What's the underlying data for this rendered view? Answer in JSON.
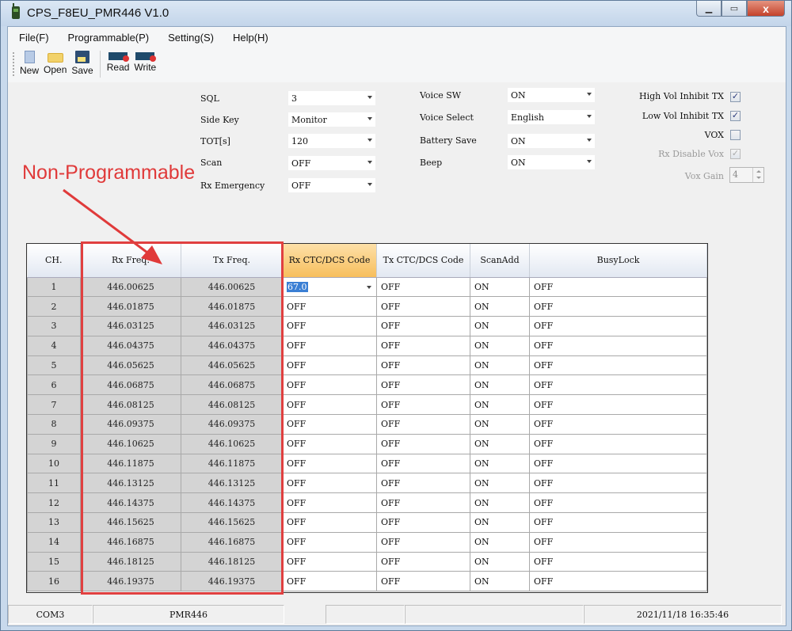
{
  "window": {
    "title": "CPS_F8EU_PMR446 V1.0",
    "controls": {
      "minimize": "minimize",
      "maximize": "maximize",
      "close": "x"
    }
  },
  "menu": [
    {
      "label": "File(F)"
    },
    {
      "label": "Programmable(P)"
    },
    {
      "label": "Setting(S)"
    },
    {
      "label": "Help(H)"
    }
  ],
  "toolbar": [
    {
      "label": "New",
      "icon": "new-file-icon"
    },
    {
      "label": "Open",
      "icon": "folder-open-icon"
    },
    {
      "label": "Save",
      "icon": "floppy-disk-icon"
    },
    {
      "label": "Read",
      "icon": "read-radio-icon"
    },
    {
      "label": "Write",
      "icon": "write-radio-icon"
    }
  ],
  "settings_left": [
    {
      "label": "SQL",
      "value": "3"
    },
    {
      "label": "Side Key",
      "value": "Monitor"
    },
    {
      "label": "TOT[s]",
      "value": "120"
    },
    {
      "label": "Scan",
      "value": "OFF"
    },
    {
      "label": "Rx Emergency",
      "value": "OFF"
    }
  ],
  "settings_mid": [
    {
      "label": "Voice SW",
      "value": "ON"
    },
    {
      "label": "Voice Select",
      "value": "English"
    },
    {
      "label": "Battery Save",
      "value": "ON"
    },
    {
      "label": "Beep",
      "value": "ON"
    }
  ],
  "settings_right": [
    {
      "label": "High Vol Inhibit TX",
      "checked": true,
      "mark": "✓",
      "disabled": false
    },
    {
      "label": "Low Vol Inhibit TX",
      "checked": true,
      "mark": "✓",
      "disabled": false
    },
    {
      "label": "VOX",
      "checked": false,
      "mark": "",
      "disabled": false
    },
    {
      "label": "Rx Disable Vox",
      "checked": true,
      "mark": "✓",
      "disabled": true
    }
  ],
  "vox_gain": {
    "label": "Vox Gain",
    "value": "4"
  },
  "annotation": {
    "text": "Non-Programmable",
    "color": "#e03a3a"
  },
  "grid": {
    "columns": [
      "CH.",
      "Rx Freq.",
      "Tx Freq.",
      "Rx CTC/DCS Code",
      "Tx CTC/DCS Code",
      "ScanAdd",
      "BusyLock"
    ],
    "active_column": 3,
    "rows": [
      [
        "1",
        "446.00625",
        "446.00625",
        "67.0",
        "OFF",
        "ON",
        "OFF"
      ],
      [
        "2",
        "446.01875",
        "446.01875",
        "OFF",
        "OFF",
        "ON",
        "OFF"
      ],
      [
        "3",
        "446.03125",
        "446.03125",
        "OFF",
        "OFF",
        "ON",
        "OFF"
      ],
      [
        "4",
        "446.04375",
        "446.04375",
        "OFF",
        "OFF",
        "ON",
        "OFF"
      ],
      [
        "5",
        "446.05625",
        "446.05625",
        "OFF",
        "OFF",
        "ON",
        "OFF"
      ],
      [
        "6",
        "446.06875",
        "446.06875",
        "OFF",
        "OFF",
        "ON",
        "OFF"
      ],
      [
        "7",
        "446.08125",
        "446.08125",
        "OFF",
        "OFF",
        "ON",
        "OFF"
      ],
      [
        "8",
        "446.09375",
        "446.09375",
        "OFF",
        "OFF",
        "ON",
        "OFF"
      ],
      [
        "9",
        "446.10625",
        "446.10625",
        "OFF",
        "OFF",
        "ON",
        "OFF"
      ],
      [
        "10",
        "446.11875",
        "446.11875",
        "OFF",
        "OFF",
        "ON",
        "OFF"
      ],
      [
        "11",
        "446.13125",
        "446.13125",
        "OFF",
        "OFF",
        "ON",
        "OFF"
      ],
      [
        "12",
        "446.14375",
        "446.14375",
        "OFF",
        "OFF",
        "ON",
        "OFF"
      ],
      [
        "13",
        "446.15625",
        "446.15625",
        "OFF",
        "OFF",
        "ON",
        "OFF"
      ],
      [
        "14",
        "446.16875",
        "446.16875",
        "OFF",
        "OFF",
        "ON",
        "OFF"
      ],
      [
        "15",
        "446.18125",
        "446.18125",
        "OFF",
        "OFF",
        "ON",
        "OFF"
      ],
      [
        "16",
        "446.19375",
        "446.19375",
        "OFF",
        "OFF",
        "ON",
        "OFF"
      ]
    ]
  },
  "statusbar": [
    "COM3",
    "PMR446",
    "",
    "",
    "2021/11/18 16:35:46"
  ]
}
